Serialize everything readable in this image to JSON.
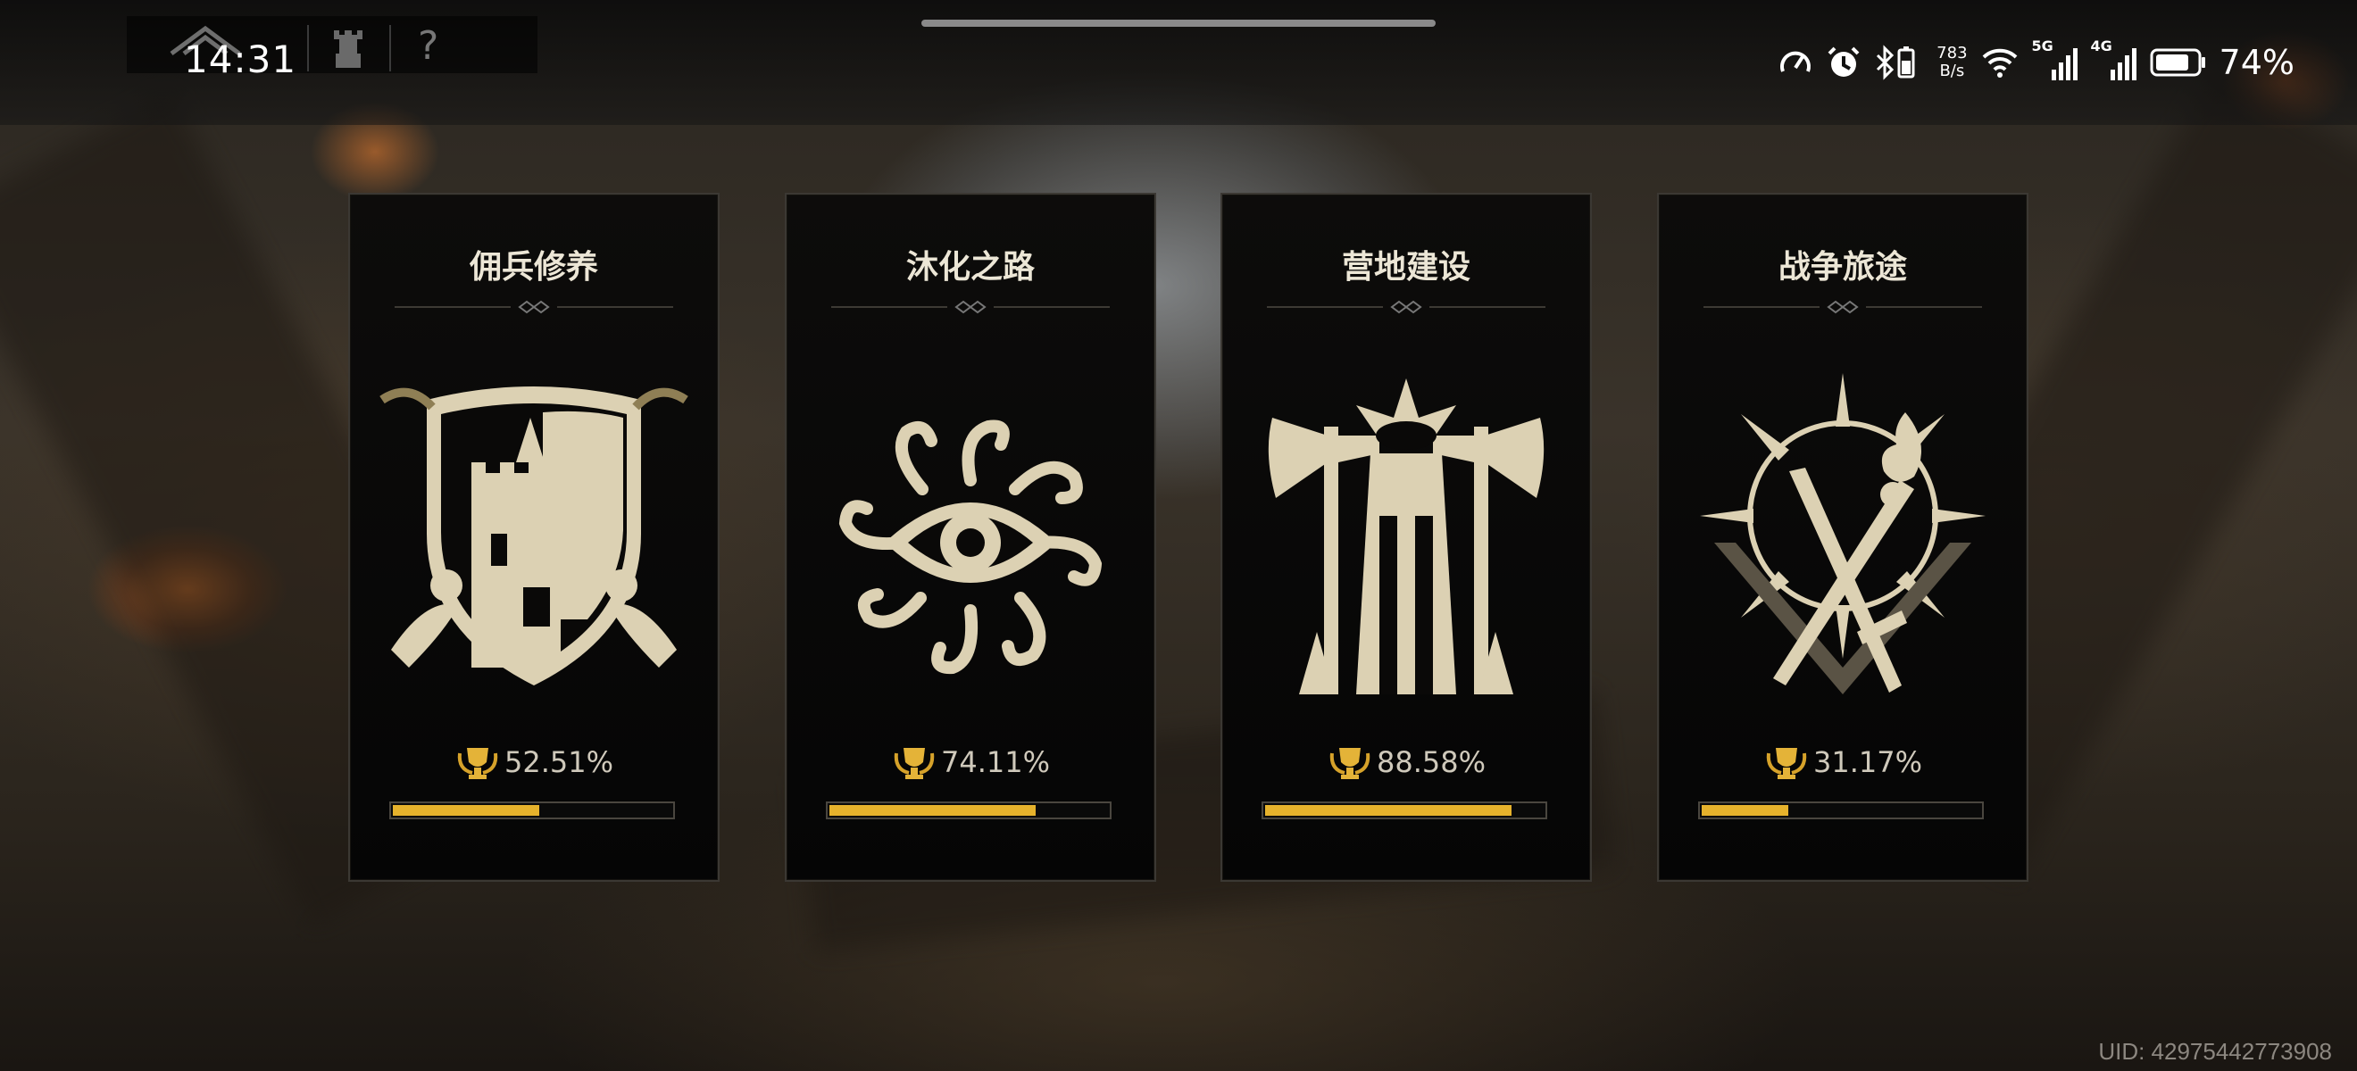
{
  "status_bar": {
    "time": "14:31",
    "net_speed_value": "783",
    "net_speed_unit": "B/s",
    "sim1_label": "5G",
    "sim2_label": "4G",
    "battery_percent": "74%"
  },
  "hud": {
    "icons": [
      "logo-icon",
      "castle-icon",
      "help-icon"
    ],
    "help_glyph": "?"
  },
  "cards": [
    {
      "title": "佣兵修养",
      "progress_label": "52.51%",
      "progress": 0.5251,
      "emblem": "shield-castle-emblem"
    },
    {
      "title": "沐化之路",
      "progress_label": "74.11%",
      "progress": 0.7411,
      "emblem": "eye-tentacle-emblem"
    },
    {
      "title": "营地建设",
      "progress_label": "88.58%",
      "progress": 0.8858,
      "emblem": "axes-tower-emblem"
    },
    {
      "title": "战争旅途",
      "progress_label": "31.17%",
      "progress": 0.3117,
      "emblem": "sword-torch-emblem"
    }
  ],
  "uid_text": "UID: 42975442773908",
  "colors": {
    "progress_fill": "#e6b22c",
    "emblem": "#dcd1b3",
    "card_bg": "#080808"
  }
}
